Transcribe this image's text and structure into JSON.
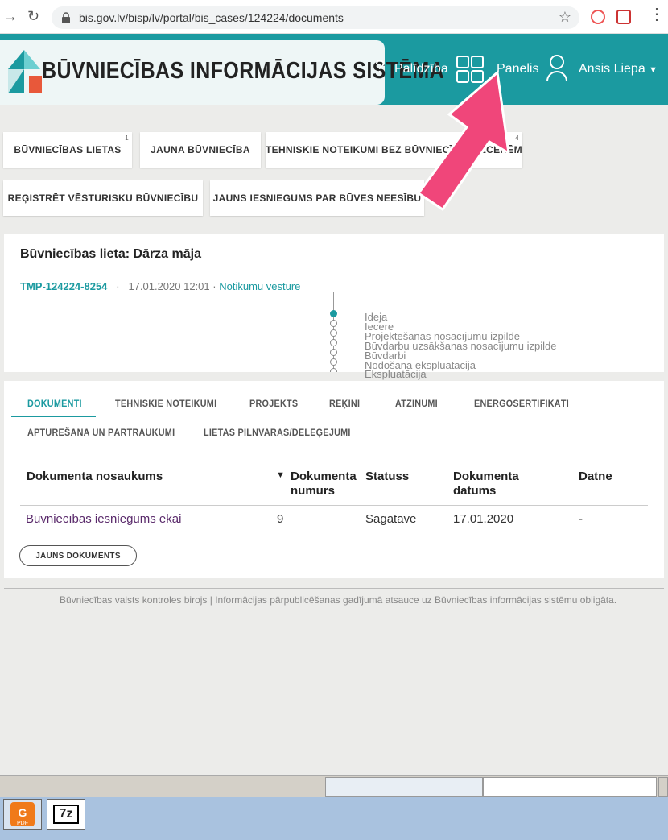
{
  "browser": {
    "url": "bis.gov.lv/bisp/lv/portal/bis_cases/124224/documents"
  },
  "header": {
    "title": "BŪVNIECĪBAS INFORMĀCIJAS SISTĒMA",
    "help_label": "Palīdzība",
    "panel_label": "Panelis",
    "user_name": "Ansis Liepa"
  },
  "tiles": [
    {
      "label": "BŪVNIECĪBAS LIETAS",
      "badge": "1"
    },
    {
      "label": "JAUNA BŪVNIECĪBA",
      "badge": ""
    },
    {
      "label": "TEHNISKIE NOTEIKUMI BEZ BŪVNIECĪBAS IECERĒM",
      "badge": "4"
    },
    {
      "label": "REĢISTRĒT VĒSTURISKU BŪVNIECĪBU",
      "badge": ""
    },
    {
      "label": "JAUNS IESNIEGUMS PAR BŪVES NEESĪBU",
      "badge": ""
    }
  ],
  "case": {
    "title": "Būvniecības lieta: Dārza māja",
    "id": "TMP-124224-8254",
    "datetime": "17.01.2020 12:01",
    "history_link": "Notikumu vēsture",
    "stages": [
      "Ideja",
      "Iecere",
      "Projektēšanas nosacījumu izpilde",
      "Būvdarbu uzsākšanas nosacījumu izpilde",
      "Būvdarbi",
      "Nodošana ekspluatācijā",
      "Ekspluatācija"
    ]
  },
  "tabs": [
    {
      "label": "DOKUMENTI",
      "active": true
    },
    {
      "label": "TEHNISKIE NOTEIKUMI",
      "active": false
    },
    {
      "label": "PROJEKTS",
      "active": false
    },
    {
      "label": "RĒĶINI",
      "active": false
    },
    {
      "label": "ATZINUMI",
      "active": false
    },
    {
      "label": "ENERGOSERTIFIKĀTI",
      "active": false
    },
    {
      "label": "APTURĒŠANA UN PĀRTRAUKUMI",
      "active": false
    },
    {
      "label": "LIETAS PILNVARAS/DELEĢĒJUMI",
      "active": false
    }
  ],
  "table": {
    "headers": {
      "name": "Dokumenta nosaukums",
      "number_line1": "Dokumenta",
      "number_line2": "numurs",
      "status": "Statuss",
      "date_line1": "Dokumenta",
      "date_line2": "datums",
      "file": "Datne"
    },
    "rows": [
      {
        "name": "Būvniecības iesniegums ēkai",
        "number": "9",
        "status": "Sagatave",
        "date": "17.01.2020",
        "file": "-"
      }
    ],
    "new_button": "JAUNS DOKUMENTS"
  },
  "footer": {
    "text": "Būvniecības valsts kontroles birojs | Informācijas pārpublicēšanas gadījumā atsauce uz Būvniecības informācijas sistēmu obligāta."
  },
  "taskbar": {
    "pdf_label": "PDF",
    "zip_label": "7z"
  },
  "colors": {
    "accent": "#1b9aa0",
    "annotation_arrow": "#f0467a"
  }
}
